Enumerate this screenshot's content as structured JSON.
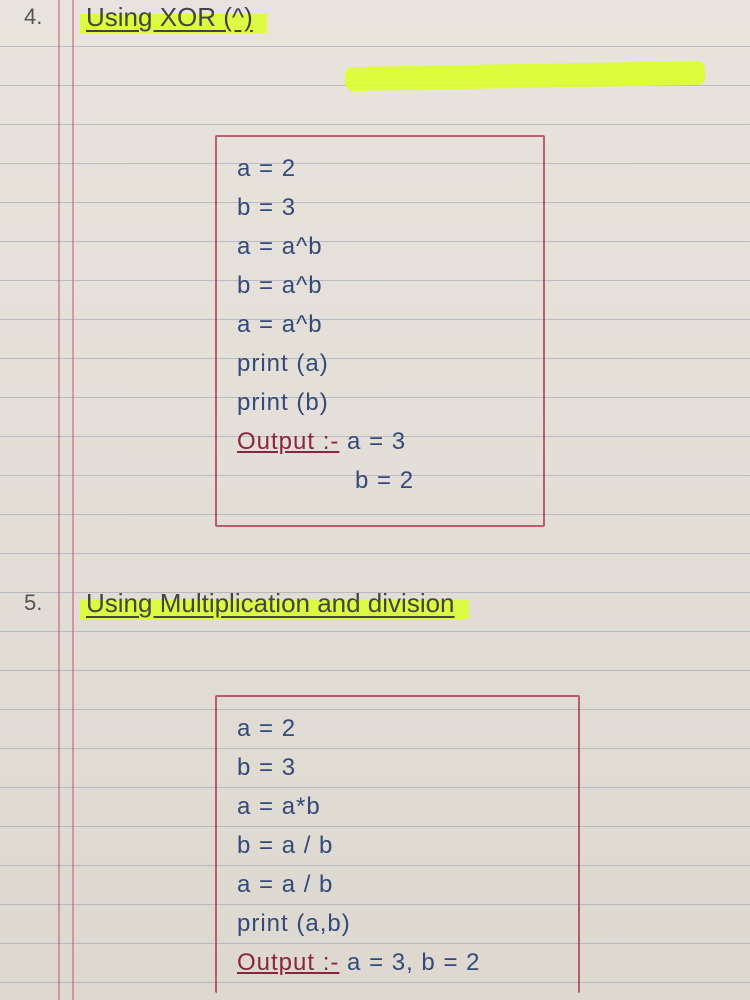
{
  "section4": {
    "number": "4.",
    "title": "Using XOR (^)",
    "code": {
      "l1": "a = 2",
      "l2": "b = 3",
      "l3": "a = a^b",
      "l4": "b = a^b",
      "l5": "a = a^b",
      "l6": "print (a)",
      "l7": "print (b)",
      "output_label": "Output :-",
      "out1": "a = 3",
      "out2": "b = 2"
    }
  },
  "section5": {
    "number": "5.",
    "title": "Using Multiplication and division",
    "code": {
      "l1": "a = 2",
      "l2": "b = 3",
      "l3": "a = a*b",
      "l4": "b = a / b",
      "l5": "a = a / b",
      "l6": "print (a,b)",
      "output_label": "Output :-",
      "out1": "a = 3, b = 2"
    }
  }
}
